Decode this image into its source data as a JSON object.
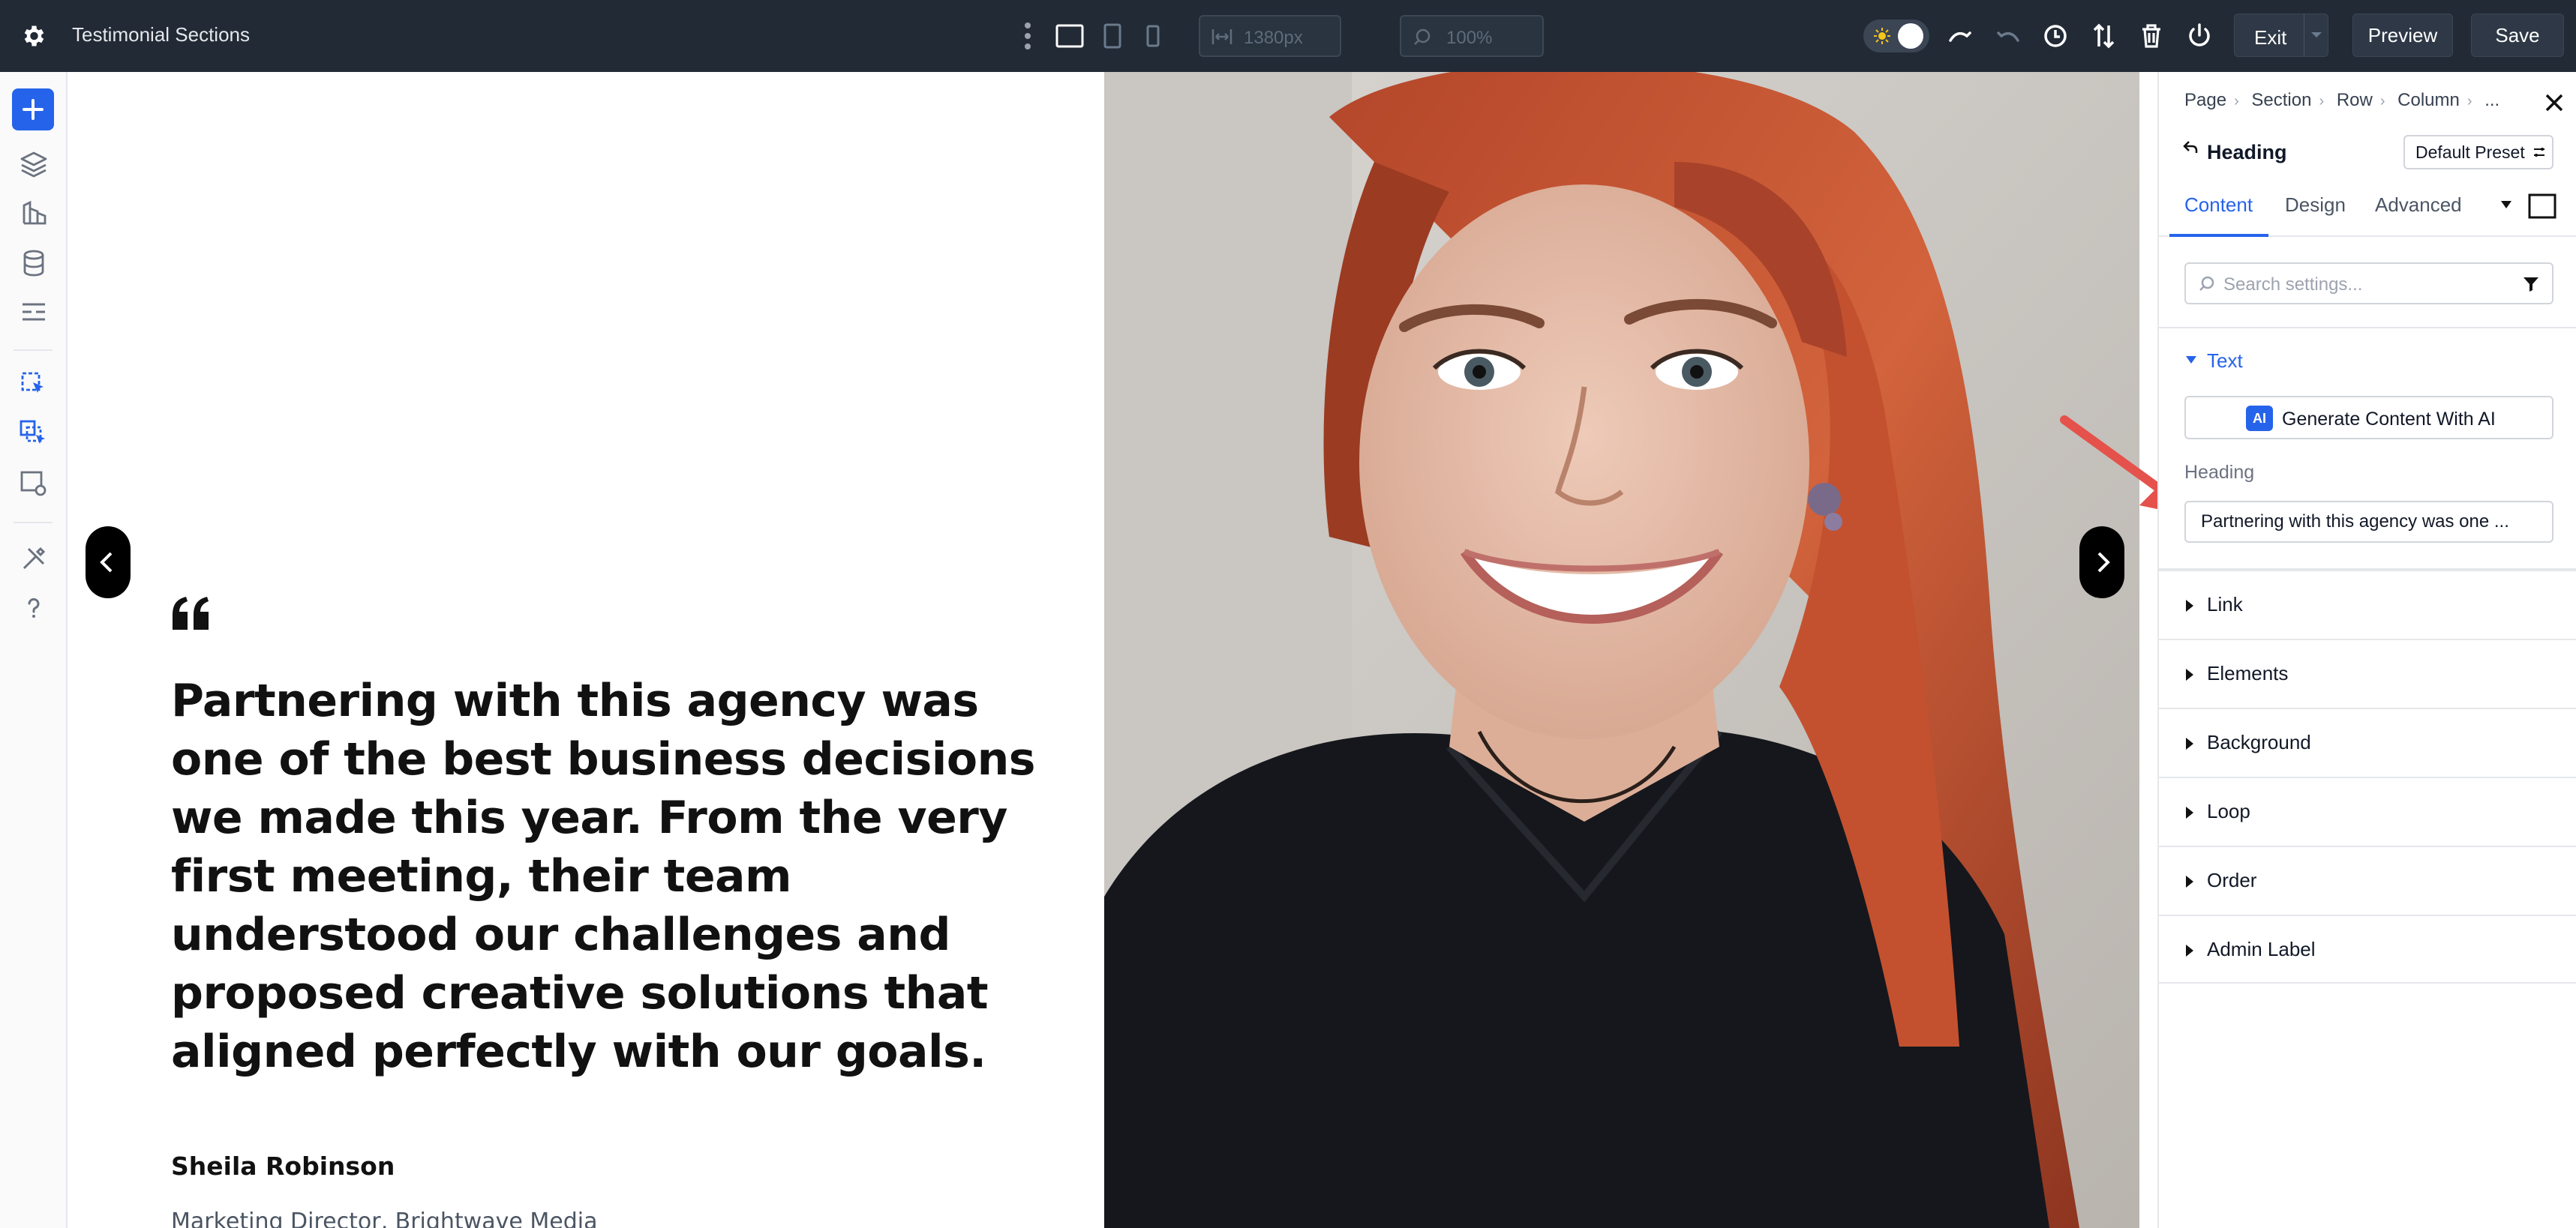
{
  "app": {
    "title": "Testimonial Sections",
    "width_value": "1380px",
    "zoom_value": "100%",
    "exit_label": "Exit",
    "preview_label": "Preview",
    "save_label": "Save"
  },
  "testimonial": {
    "quote": "Partnering with this agency was one of the best business decisions we made this year. From the very first meeting, their team understood our challenges and proposed creative solutions that aligned perfectly with our goals.",
    "author": "Sheila Robinson",
    "role": "Marketing Director, Brightwave Media"
  },
  "panel": {
    "breadcrumbs": [
      "Page",
      "Section",
      "Row",
      "Column",
      "..."
    ],
    "module_title": "Heading",
    "preset_label": "Default Preset",
    "tabs": [
      "Content",
      "Design",
      "Advanced"
    ],
    "search_placeholder": "Search settings...",
    "text_section": "Text",
    "ai_badge": "AI",
    "ai_button": "Generate Content With AI",
    "heading_label": "Heading",
    "heading_value": "Partnering with this agency was one ...",
    "sections": [
      "Link",
      "Elements",
      "Background",
      "Loop",
      "Order",
      "Admin Label"
    ]
  },
  "colors": {
    "topbar": "#212a35",
    "accent": "#2563eb",
    "annotation": "#e4524b"
  }
}
